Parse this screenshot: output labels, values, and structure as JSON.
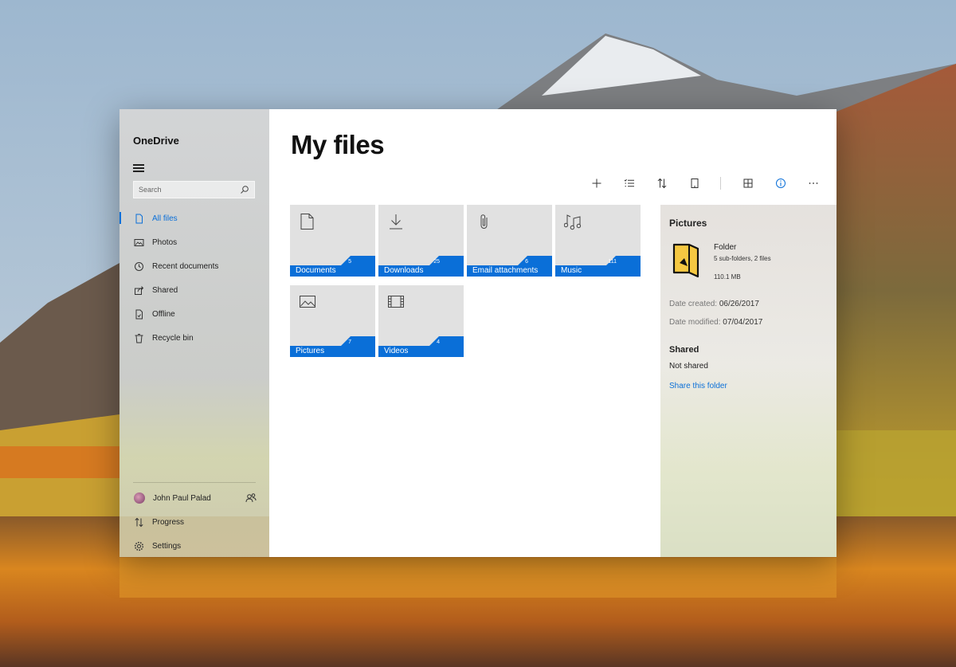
{
  "app": {
    "title": "OneDrive"
  },
  "search": {
    "placeholder": "Search"
  },
  "nav": {
    "items": [
      {
        "label": "All files",
        "icon": "file-icon",
        "active": true
      },
      {
        "label": "Photos",
        "icon": "photo-icon",
        "active": false
      },
      {
        "label": "Recent documents",
        "icon": "clock-icon",
        "active": false
      },
      {
        "label": "Shared",
        "icon": "share-icon",
        "active": false
      },
      {
        "label": "Offline",
        "icon": "offline-icon",
        "active": false
      },
      {
        "label": "Recycle bin",
        "icon": "trash-icon",
        "active": false
      }
    ]
  },
  "account": {
    "user": "John Paul Palad",
    "progress": "Progress",
    "settings": "Settings"
  },
  "main": {
    "title": "My files"
  },
  "folders": [
    {
      "label": "Documents",
      "count": "5",
      "icon": "document-icon"
    },
    {
      "label": "Downloads",
      "count": "25",
      "icon": "download-icon"
    },
    {
      "label": "Email attachments",
      "count": "6",
      "icon": "paperclip-icon"
    },
    {
      "label": "Music",
      "count": "111",
      "icon": "music-icon"
    },
    {
      "label": "Pictures",
      "count": "7",
      "icon": "picture-icon"
    },
    {
      "label": "Videos",
      "count": "4",
      "icon": "film-icon"
    }
  ],
  "details": {
    "title": "Pictures",
    "type": "Folder",
    "summary": "5 sub-folders, 2 files",
    "size": "110.1 MB",
    "created_label": "Date created:",
    "created": "06/26/2017",
    "modified_label": "Date modified:",
    "modified": "07/04/2017",
    "shared_heading": "Shared",
    "shared_status": "Not shared",
    "share_link": "Share this folder"
  },
  "colors": {
    "accent": "#0a6fd8",
    "tile_bg": "#e1e1e1",
    "folder_fill": "#f5c842"
  }
}
